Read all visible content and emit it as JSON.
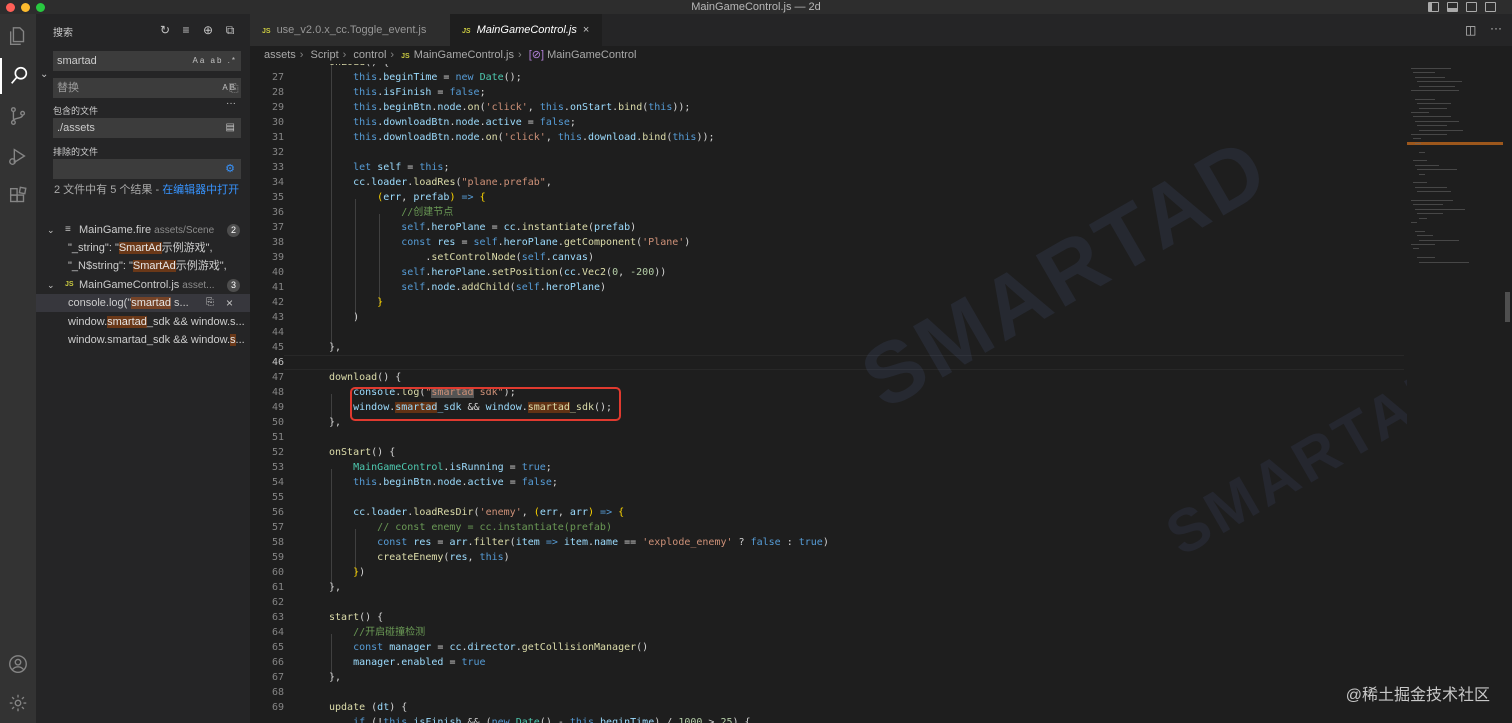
{
  "window": {
    "title": "MainGameControl.js — 2d"
  },
  "sidebar": {
    "header": "搜索",
    "search": {
      "value": "smartad",
      "options": "Aa ab .*"
    },
    "replace": {
      "value": "替换",
      "options": "AB"
    },
    "include_label": "包含的文件",
    "include_value": "./assets",
    "exclude_label": "排除的文件",
    "exclude_value": "",
    "summary_prefix": "2 文件中有 5 个结果 - ",
    "summary_link": "在编辑器中打开",
    "files": [
      {
        "name": "MainGame.fire",
        "path": "assets/Scene",
        "count": "2",
        "matches": [
          {
            "before": "\"_string\": \"",
            "hit": "SmartAd",
            "after": "示例游戏\","
          },
          {
            "before": "\"_N$string\": \"",
            "hit": "SmartAd",
            "after": "示例游戏\","
          }
        ]
      },
      {
        "name": "MainGameControl.js",
        "path": "asset...",
        "count": "3",
        "matches": [
          {
            "before": "console.log(\"",
            "hit": "smartad",
            "after": " s..."
          },
          {
            "before": "window.",
            "hit": "smartad",
            "after": "_sdk && window.s..."
          },
          {
            "before": "window.smartad_sdk && window.",
            "hit": "s",
            "after": "..."
          }
        ]
      }
    ]
  },
  "tabs": [
    {
      "label": "use_v2.0.x_cc.Toggle_event.js",
      "badge": "JS"
    },
    {
      "label": "MainGameControl.js",
      "badge": "JS",
      "close": "×"
    }
  ],
  "breadcrumb": [
    "assets",
    "Script",
    "control",
    "MainGameControl.js",
    "MainGameControl"
  ],
  "editor": {
    "line_numbers": [
      "27",
      "28",
      "29",
      "30",
      "31",
      "32",
      "33",
      "34",
      "35",
      "36",
      "37",
      "38",
      "39",
      "40",
      "41",
      "42",
      "43",
      "44",
      "45",
      "46",
      "47",
      "48",
      "49",
      "50",
      "51",
      "52",
      "53",
      "54",
      "55",
      "56",
      "57",
      "58",
      "59",
      "60",
      "61",
      "62",
      "63",
      "64",
      "65",
      "66",
      "67",
      "68",
      "69"
    ],
    "current_line": "46"
  },
  "watermark": "SMARTAD",
  "credit": "@稀土掘金技术社区",
  "colors": {
    "accent": "#007acc",
    "highlight_box": "#e03a2f",
    "match": "#ea5c00"
  }
}
